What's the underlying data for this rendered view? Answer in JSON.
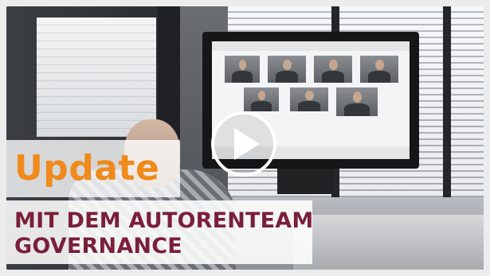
{
  "video": {
    "overlay_title": "Update",
    "subtitle_lines": [
      "MIT DEM AUTORENTEAM",
      "GOVERNANCE"
    ],
    "play_icon": "play-icon",
    "colors": {
      "title_orange": "#f08a1c",
      "subtitle_maroon": "#7a1f3a",
      "overlay_white": "#ffffff"
    }
  }
}
